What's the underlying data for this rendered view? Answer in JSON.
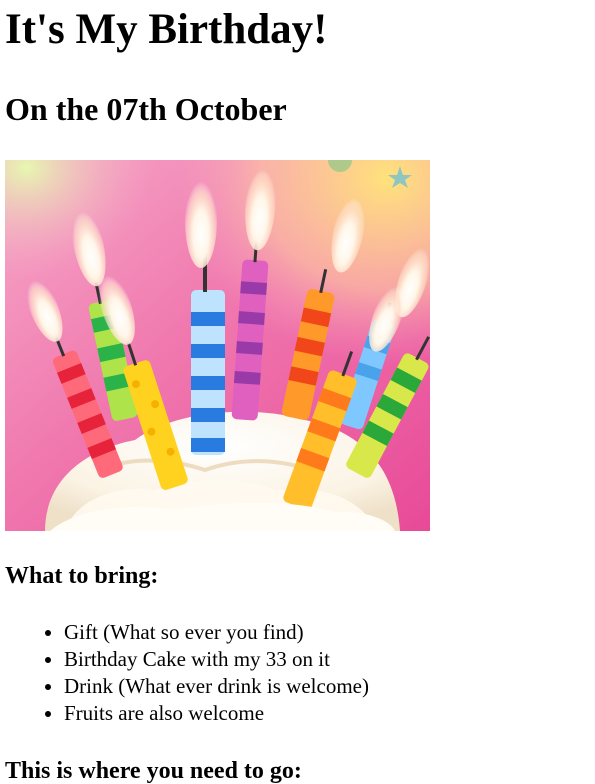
{
  "title": "It's My Birthday!",
  "subtitle": "On the 07th October",
  "photo": {
    "subject": "birthday-cupcake-with-candles"
  },
  "bring": {
    "heading": "What to bring:",
    "items": [
      "Gift (What so ever you find)",
      "Birthday Cake with my 33 on it",
      "Drink (What ever drink is welcome)",
      "Fruits are also welcome"
    ]
  },
  "directions": {
    "heading": "This is where you need to go:"
  }
}
